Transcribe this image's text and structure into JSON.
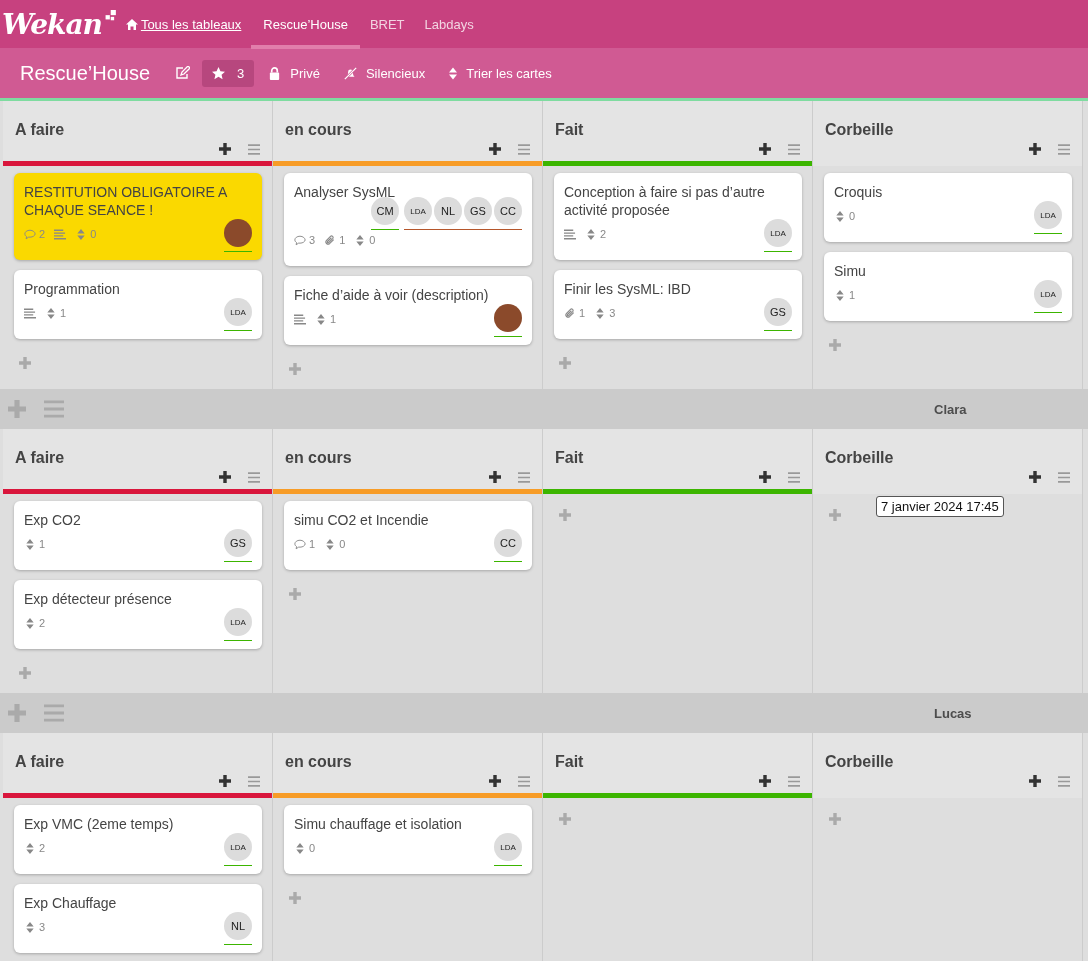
{
  "header": {
    "logo": "Wekan",
    "tabs": [
      {
        "label": "Tous les tableaux",
        "kind": "home",
        "selected": false
      },
      {
        "label": "Rescue’House",
        "kind": "board",
        "selected": true
      },
      {
        "label": "BRET",
        "kind": "board",
        "selected": false
      },
      {
        "label": "Labdays",
        "kind": "board",
        "selected": false
      }
    ]
  },
  "board_bar": {
    "title": "Rescue’House",
    "stars": "3",
    "visibility": "Privé",
    "watch": "Silencieux",
    "sort": "Trier les cartes"
  },
  "swimlanes": [
    {
      "lists": [
        {
          "title": "A faire",
          "color": "#d9163c",
          "cards": [
            {
              "title": "RESTITUTION OBLIGATOIRE A CHAQUE SEANCE !",
              "color": "#fad900",
              "badges": [
                {
                  "kind": "comments",
                  "count": "2"
                },
                {
                  "kind": "description"
                },
                {
                  "kind": "sort",
                  "count": "0"
                }
              ],
              "members": [
                {
                  "kind": "photo"
                }
              ]
            },
            {
              "title": "Programmation",
              "badges": [
                {
                  "kind": "description"
                },
                {
                  "kind": "sort",
                  "count": "1"
                }
              ],
              "members": [
                {
                  "kind": "initials",
                  "initials": "LDA"
                }
              ]
            }
          ]
        },
        {
          "title": "en cours",
          "color": "#f79c27",
          "cards": [
            {
              "title": "Analyser SysML",
              "badges": [
                {
                  "kind": "comments",
                  "count": "3"
                },
                {
                  "kind": "attachments",
                  "count": "1"
                },
                {
                  "kind": "sort",
                  "count": "0"
                }
              ],
              "members": [
                {
                  "kind": "initials",
                  "initials": "CM"
                }
              ],
              "assignees": [
                {
                  "kind": "initials",
                  "initials": "LDA"
                },
                {
                  "kind": "initials",
                  "initials": "NL"
                },
                {
                  "kind": "initials",
                  "initials": "GS"
                },
                {
                  "kind": "initials",
                  "initials": "CC"
                }
              ]
            },
            {
              "title": "Fiche d’aide à voir (description)",
              "badges": [
                {
                  "kind": "description"
                },
                {
                  "kind": "sort",
                  "count": "1"
                }
              ],
              "members": [
                {
                  "kind": "photo"
                }
              ]
            }
          ]
        },
        {
          "title": "Fait",
          "color": "#3cb500",
          "cards": [
            {
              "title": "Conception à faire si pas d’autre activité proposée",
              "badges": [
                {
                  "kind": "description"
                },
                {
                  "kind": "sort",
                  "count": "2"
                }
              ],
              "members": [
                {
                  "kind": "initials",
                  "initials": "LDA"
                }
              ]
            },
            {
              "title": "Finir les SysML: IBD",
              "badges": [
                {
                  "kind": "attachments",
                  "count": "1"
                },
                {
                  "kind": "sort",
                  "count": "3"
                }
              ],
              "members": [
                {
                  "kind": "initials",
                  "initials": "GS"
                }
              ]
            }
          ]
        },
        {
          "title": "Corbeille",
          "cards": [
            {
              "title": "Croquis",
              "badges": [
                {
                  "kind": "sort",
                  "count": "0"
                }
              ],
              "members": [
                {
                  "kind": "initials",
                  "initials": "LDA"
                }
              ]
            },
            {
              "title": "Simu",
              "badges": [
                {
                  "kind": "sort",
                  "count": "1"
                }
              ],
              "members": [
                {
                  "kind": "initials",
                  "initials": "LDA"
                }
              ]
            }
          ]
        }
      ]
    },
    {
      "title": "Clara",
      "lists": [
        {
          "title": "A faire",
          "color": "#d9163c",
          "cards": [
            {
              "title": "Exp CO2",
              "badges": [
                {
                  "kind": "sort",
                  "count": "1"
                }
              ],
              "members": [
                {
                  "kind": "initials",
                  "initials": "GS"
                }
              ]
            },
            {
              "title": "Exp détecteur présence",
              "badges": [
                {
                  "kind": "sort",
                  "count": "2"
                }
              ],
              "members": [
                {
                  "kind": "initials",
                  "initials": "LDA"
                }
              ]
            }
          ]
        },
        {
          "title": "en cours",
          "color": "#f79c27",
          "cards": [
            {
              "title": "simu CO2 et Incendie",
              "badges": [
                {
                  "kind": "comments",
                  "count": "1"
                },
                {
                  "kind": "sort",
                  "count": "0"
                }
              ],
              "members": [
                {
                  "kind": "initials",
                  "initials": "CC"
                }
              ]
            }
          ]
        },
        {
          "title": "Fait",
          "color": "#3cb500"
        },
        {
          "title": "Corbeille",
          "tooltip": "7 janvier 2024 17:45"
        }
      ]
    },
    {
      "title": "Lucas",
      "lists": [
        {
          "title": "A faire",
          "color": "#d9163c",
          "cards": [
            {
              "title": "Exp VMC (2eme temps)",
              "badges": [
                {
                  "kind": "sort",
                  "count": "2"
                }
              ],
              "members": [
                {
                  "kind": "initials",
                  "initials": "LDA"
                }
              ]
            },
            {
              "title": "Exp Chauffage",
              "badges": [
                {
                  "kind": "sort",
                  "count": "3"
                }
              ],
              "members": [
                {
                  "kind": "initials",
                  "initials": "NL"
                }
              ]
            }
          ]
        },
        {
          "title": "en cours",
          "color": "#f79c27",
          "cards": [
            {
              "title": "Simu chauffage et isolation",
              "badges": [
                {
                  "kind": "sort",
                  "count": "0"
                }
              ],
              "members": [
                {
                  "kind": "initials",
                  "initials": "LDA"
                }
              ]
            }
          ]
        },
        {
          "title": "Fait",
          "color": "#3cb500"
        },
        {
          "title": "Corbeille"
        }
      ]
    }
  ]
}
